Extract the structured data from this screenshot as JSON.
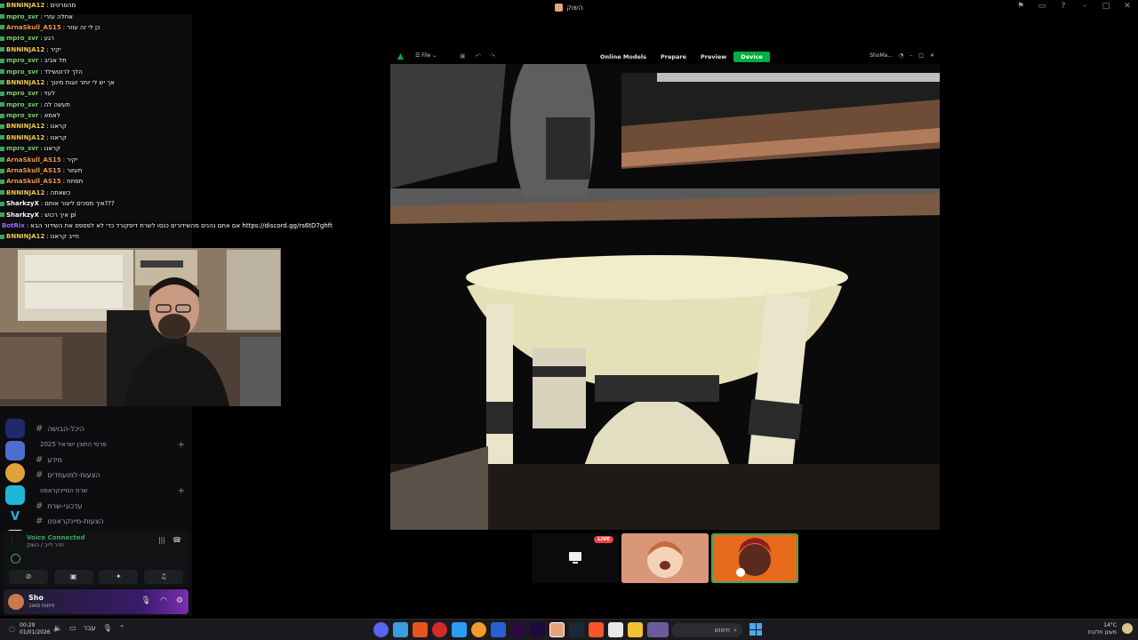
{
  "window": {
    "title": "השוק"
  },
  "chat": [
    {
      "user": "BNNINJA12",
      "color": "#f2c94c",
      "msg": "מהסרטים"
    },
    {
      "user": "mpro_svr",
      "color": "#7ad46a",
      "msg": "אחלה עזרי"
    },
    {
      "user": "ArnaSkull_AS15",
      "color": "#f2994a",
      "msg": "כן לי זה עוזר"
    },
    {
      "user": "mpro_svr",
      "color": "#7ad46a",
      "msg": "רגע"
    },
    {
      "user": "BNNINJA12",
      "color": "#f2c94c",
      "msg": "יקיר"
    },
    {
      "user": "mpro_svr",
      "color": "#7ad46a",
      "msg": "תל אביב"
    },
    {
      "user": "mpro_svr",
      "color": "#7ad46a",
      "msg": "הלך לרוטשילד"
    },
    {
      "user": "BNNINJA12",
      "color": "#f2c94c",
      "msg": "אך יש לי יותר זוגות מינוך"
    },
    {
      "user": "mpro_svr",
      "color": "#7ad46a",
      "msg": "לעזי"
    },
    {
      "user": "mpro_svr",
      "color": "#7ad46a",
      "msg": "תעשה לה"
    },
    {
      "user": "mpro_svr",
      "color": "#7ad46a",
      "msg": "לאמא"
    },
    {
      "user": "BNNINJA12",
      "color": "#f2c94c",
      "msg": "קראנו"
    },
    {
      "user": "BNNINJA12",
      "color": "#f2c94c",
      "msg": "קראנו"
    },
    {
      "user": "mpro_svr",
      "color": "#7ad46a",
      "msg": "קראנו"
    },
    {
      "user": "ArnaSkull_AS15",
      "color": "#f2994a",
      "msg": "יקיר"
    },
    {
      "user": "ArnaSkull_AS15",
      "color": "#f2994a",
      "msg": "תעזור"
    },
    {
      "user": "ArnaSkull_AS15",
      "color": "#f2994a",
      "msg": "תפתח"
    },
    {
      "user": "BNNINJA12",
      "color": "#f2c94c",
      "msg": "כשאתה"
    },
    {
      "user": "SharkzyX",
      "color": "#ffffff",
      "msg": "איך מסכים ליצור אותם???"
    },
    {
      "user": "SharkzyX",
      "color": "#ffffff",
      "msg": "איך רכוש pi"
    },
    {
      "user": "BotRix",
      "color": "#a66bff",
      "msg": "אם אתם נהנים מהשידורים כנסו לשרת דיסקורד כדי לא לפספס את השידור הבא https://discord.gg/rs6tD7ghft"
    },
    {
      "user": "BNNINJA12",
      "color": "#f2c94c",
      "msg": "חייב קראנו"
    }
  ],
  "sidebar": {
    "channels": [
      {
        "type": "channel",
        "label": "היכל-הבושה"
      },
      {
        "type": "category",
        "label": "פרסי התוכן ישראל 2025"
      },
      {
        "type": "channel",
        "label": "מידע"
      },
      {
        "type": "channel",
        "label": "הצעות-למועמדים"
      },
      {
        "type": "category",
        "label": "שרת המיינקראפט"
      },
      {
        "type": "channel",
        "label": "עדכוני-שרת"
      },
      {
        "type": "channel",
        "label": "הצעות-מיינקראפט"
      }
    ]
  },
  "voice": {
    "title": "Voice Connected",
    "subtitle": "חדר לייב / השוק"
  },
  "user": {
    "name": "Sho",
    "status": "פיתוח סאוב"
  },
  "bambu": {
    "file_label": "File",
    "tabs": [
      "Online Models",
      "Prepare",
      "Preview",
      "Device"
    ],
    "active_tab": "Device",
    "right_label": "ShoMa..."
  },
  "participants": {
    "live_label": "LIVE"
  },
  "taskbar": {
    "time": "00:29",
    "date": "01/01/2026",
    "lang": "עבר",
    "search_placeholder": "חיפוש",
    "weather_temp": "14°C",
    "weather_desc": "מעונן חלקית"
  },
  "colors": {
    "accent_green": "#00ae42",
    "discord_green": "#3ba55c",
    "live_red": "#ed4245"
  }
}
